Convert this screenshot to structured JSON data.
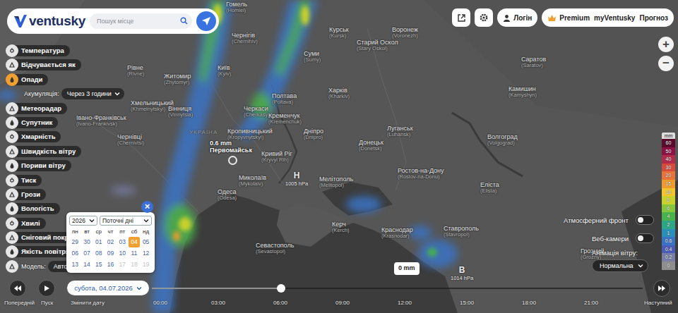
{
  "header": {
    "logo": "ventusky",
    "search": {
      "placeholder": "Пошук місце"
    },
    "login": "Логін",
    "premium": [
      "Premium",
      "myVentusky",
      "Прогноз"
    ]
  },
  "zoom": [
    "+",
    "−"
  ],
  "layers": [
    {
      "kind": "layer",
      "label": "Температура",
      "selected": false
    },
    {
      "kind": "layer",
      "label": "Відчувається як",
      "selected": false
    },
    {
      "kind": "layer",
      "label": "Опади",
      "selected": true
    },
    {
      "kind": "select",
      "label": "Акумуляція:",
      "value": "Через 3 години"
    },
    {
      "kind": "layer",
      "label": "Метеорадар",
      "selected": false
    },
    {
      "kind": "layer",
      "label": "Супутник",
      "selected": false
    },
    {
      "kind": "layer",
      "label": "Хмарність",
      "selected": false
    },
    {
      "kind": "layer",
      "label": "Швидкість вітру",
      "selected": false
    },
    {
      "kind": "layer",
      "label": "Пориви вітру",
      "selected": false
    },
    {
      "kind": "layer",
      "label": "Тиск",
      "selected": false
    },
    {
      "kind": "layer",
      "label": "Грози",
      "selected": false
    },
    {
      "kind": "layer",
      "label": "Вологість",
      "selected": false
    },
    {
      "kind": "layer",
      "label": "Хвилі",
      "selected": false
    },
    {
      "kind": "layer",
      "label": "Сніговий покри",
      "selected": false
    },
    {
      "kind": "layer",
      "label": "Якість повітря",
      "selected": false
    },
    {
      "kind": "select",
      "label": "Модель:",
      "value": "Автомати"
    }
  ],
  "calendar": {
    "year": "2026",
    "range": "Поточні дні",
    "close": "×",
    "weekdays": [
      "пн",
      "вт",
      "ср",
      "чт",
      "пт",
      "сб",
      "нд"
    ],
    "days": [
      {
        "day": "29",
        "selected": false,
        "disabled": false
      },
      {
        "day": "30",
        "selected": false,
        "disabled": false
      },
      {
        "day": "01",
        "selected": false,
        "disabled": false
      },
      {
        "day": "02",
        "selected": false,
        "disabled": false
      },
      {
        "day": "03",
        "selected": false,
        "disabled": false
      },
      {
        "day": "04",
        "selected": true,
        "disabled": false
      },
      {
        "day": "05",
        "selected": false,
        "disabled": false
      },
      {
        "day": "06",
        "selected": false,
        "disabled": false
      },
      {
        "day": "07",
        "selected": false,
        "disabled": false
      },
      {
        "day": "08",
        "selected": false,
        "disabled": false
      },
      {
        "day": "09",
        "selected": false,
        "disabled": false
      },
      {
        "day": "10",
        "selected": false,
        "disabled": false
      },
      {
        "day": "11",
        "selected": false,
        "disabled": false
      },
      {
        "day": "12",
        "selected": false,
        "disabled": false
      },
      {
        "day": "13",
        "selected": false,
        "disabled": false
      },
      {
        "day": "14",
        "selected": false,
        "disabled": false
      },
      {
        "day": "15",
        "selected": false,
        "disabled": false
      },
      {
        "day": "16",
        "selected": false,
        "disabled": false
      },
      {
        "day": "17",
        "selected": false,
        "disabled": true
      },
      {
        "day": "18",
        "selected": false,
        "disabled": true
      },
      {
        "day": "19",
        "selected": false,
        "disabled": true
      }
    ]
  },
  "date": {
    "label": "субота, 04.07.2026"
  },
  "timeline": {
    "prev": "Попередній",
    "play": "Пуск",
    "change_date": "Змінити дату",
    "next": "Наступний",
    "times": [
      "00:00",
      "03:00",
      "06:00",
      "09:00",
      "12:00",
      "15:00",
      "18:00",
      "21:00"
    ],
    "level": 0.263
  },
  "legend": {
    "unit": "mm",
    "items": [
      {
        "value": "60",
        "color": "#5a0b2c"
      },
      {
        "value": "50",
        "color": "#8c1246"
      },
      {
        "value": "40",
        "color": "#b02c4c"
      },
      {
        "value": "30",
        "color": "#d84a3c"
      },
      {
        "value": "20",
        "color": "#e9743a"
      },
      {
        "value": "15",
        "color": "#ef9b2e"
      },
      {
        "value": "10",
        "color": "#f3c62d"
      },
      {
        "value": "8",
        "color": "#c9d22c"
      },
      {
        "value": "6",
        "color": "#86c63c"
      },
      {
        "value": "4",
        "color": "#48b34c"
      },
      {
        "value": "2",
        "color": "#2ea586"
      },
      {
        "value": "1",
        "color": "#2b8fb8"
      },
      {
        "value": "0.6",
        "color": "#3a73c4"
      },
      {
        "value": "0.4",
        "color": "#4b5bb8"
      },
      {
        "value": "0.2",
        "color": "#7a7fa8"
      },
      {
        "value": "0",
        "color": "#8e8e8e"
      }
    ]
  },
  "right_panel": {
    "front": {
      "label": "Атмосферний фронт",
      "on": false
    },
    "webcams": {
      "label": "Веб-камери",
      "on": false
    },
    "wind_animation": {
      "label": "Анімація вітру:",
      "value": "Нормальна"
    }
  },
  "map": {
    "country": "УКРАЇНА",
    "cities": [
      {
        "name": "Гомель",
        "sub": "(Homiel)"
      },
      {
        "name": "Чернігів",
        "sub": "(Chernihiv)"
      },
      {
        "name": "Курськ",
        "sub": "(Kursk)"
      },
      {
        "name": "Воронеж",
        "sub": "(Voronezh)"
      },
      {
        "name": "Старий Оскол",
        "sub": "(Stary Oskol)"
      },
      {
        "name": "Саратов",
        "sub": "(Saratov)"
      },
      {
        "name": "Суми",
        "sub": "(Sumy)"
      },
      {
        "name": "Житомир",
        "sub": "(Zhytomyr)"
      },
      {
        "name": "Київ",
        "sub": "(Kyiv)"
      },
      {
        "name": "Рівне",
        "sub": "(Rivne)"
      },
      {
        "name": "Харків",
        "sub": "(Kharkiv)"
      },
      {
        "name": "Полтава",
        "sub": "(Poltava)"
      },
      {
        "name": "Хмельницький",
        "sub": "(Khmelnytskyi)"
      },
      {
        "name": "Вінниця",
        "sub": "(Vinnytsia)"
      },
      {
        "name": "Черкаси",
        "sub": "(Cherkasy)"
      },
      {
        "name": "Кременчук",
        "sub": "(Kremenchuk)"
      },
      {
        "name": "Івано-Франківськ",
        "sub": "(Ivano-Frankivsk)"
      },
      {
        "name": "Чернівці",
        "sub": "(Chernivtsi)"
      },
      {
        "name": "Камишин",
        "sub": "(Kamyshyn)"
      },
      {
        "name": "Луганськ",
        "sub": "(Luhansk)"
      },
      {
        "name": "Кропивницький",
        "sub": "(Kropyvnytskyi)"
      },
      {
        "name": "Дніпро",
        "sub": "(Dnipro)"
      },
      {
        "name": "Волгоград",
        "sub": "(Volgograd)"
      },
      {
        "name": "Донецьк",
        "sub": "(Donetsk)"
      },
      {
        "name": "Кривий Ріг",
        "sub": "(Kryvyi Rih)"
      },
      {
        "name": "Миколаїв",
        "sub": "(Mykolaiv)"
      },
      {
        "name": "Ростов-на-Дону",
        "sub": "(Rostov-na-Donu)"
      },
      {
        "name": "Мелітополь",
        "sub": "(Melitopol)"
      },
      {
        "name": "Одеса",
        "sub": "(Odesa)"
      },
      {
        "name": "Еліста",
        "sub": "(Elista)"
      },
      {
        "name": "Керч",
        "sub": "(Kerch)"
      },
      {
        "name": "Краснодар",
        "sub": "(Krasnodar)"
      },
      {
        "name": "Ставрополь",
        "sub": "(Stavropol)"
      },
      {
        "name": "Севастополь",
        "sub": "(Sevastopol)"
      },
      {
        "name": "Грозний",
        "sub": "(Grozny)"
      }
    ],
    "pin": {
      "value": "0.6 mm",
      "name": "Первомайськ"
    },
    "pressure": [
      {
        "letter": "H",
        "value": "1005 hPa"
      },
      {
        "letter": "B",
        "value": "1014 hPa"
      }
    ],
    "tooltip": "0 mm"
  }
}
